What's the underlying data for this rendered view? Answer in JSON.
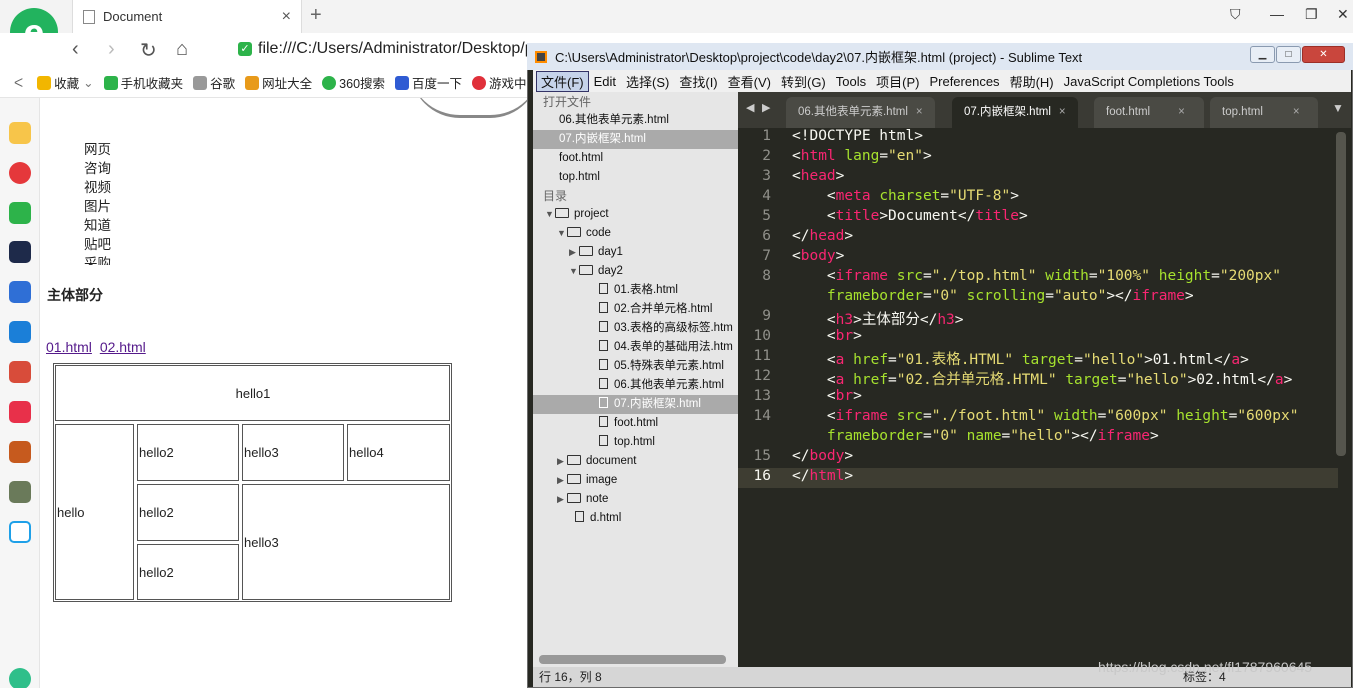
{
  "browser": {
    "tab_title": "Document",
    "tab_close": "×",
    "new_tab": "+",
    "address": "file:///C:/Users/Administrator/Desktop/p",
    "bookmarks": [
      {
        "label": "收藏",
        "icon": "star-icon",
        "color": "#f2b600"
      },
      {
        "label": "手机收藏夹",
        "icon": "phone-icon",
        "color": "#2db34a"
      },
      {
        "label": "谷歌",
        "icon": "page-icon",
        "color": "#999999"
      },
      {
        "label": "网址大全",
        "icon": "globe-icon",
        "color": "#e89a1a"
      },
      {
        "label": "360搜索",
        "icon": "search-360-icon",
        "color": "#2db34a"
      },
      {
        "label": "百度一下",
        "icon": "paw-icon",
        "color": "#2f5bd3"
      },
      {
        "label": "游戏中心",
        "icon": "game-icon",
        "color": "#e0303a"
      }
    ]
  },
  "page": {
    "menu_items": [
      "网页",
      "咨询",
      "视频",
      "图片",
      "知道",
      "贴吧",
      "采购"
    ],
    "heading": "主体部分",
    "links": [
      "01.html",
      "02.html"
    ],
    "table": {
      "top": "hello1",
      "left": "hello",
      "r1": [
        "hello2",
        "hello3",
        "hello4"
      ],
      "r2": "hello2",
      "r3": "hello2",
      "merged": "hello3"
    }
  },
  "sublime": {
    "title": "C:\\Users\\Administrator\\Desktop\\project\\code\\day2\\07.内嵌框架.html (project) - Sublime Text",
    "menus": [
      "文件(F)",
      "Edit",
      "选择(S)",
      "查找(I)",
      "查看(V)",
      "转到(G)",
      "Tools",
      "项目(P)",
      "Preferences",
      "帮助(H)",
      "JavaScript Completions Tools"
    ],
    "open_files_header": "打开文件",
    "open_files": [
      "06.其他表单元素.html",
      "07.内嵌框架.html",
      "foot.html",
      "top.html"
    ],
    "folders_header": "目录",
    "tree": {
      "project": "project",
      "code": "code",
      "day1": "day1",
      "day2": "day2",
      "day2_files": [
        "01.表格.html",
        "02.合并单元格.html",
        "03.表格的高级标签.htm",
        "04.表单的基础用法.htm",
        "05.特殊表单元素.html",
        "06.其他表单元素.html",
        "07.内嵌框架.html",
        "foot.html",
        "top.html"
      ],
      "others": [
        "document",
        "image",
        "note"
      ],
      "root_file": "d.html"
    },
    "tabs": [
      "06.其他表单元素.html",
      "07.内嵌框架.html",
      "foot.html",
      "top.html"
    ],
    "status": "行 16，列 8",
    "status_right": "标签：4",
    "watermark": "https://blog.csdn.net/fl1787960645",
    "line_numbers": [
      "1",
      "2",
      "3",
      "4",
      "5",
      "6",
      "7",
      "8",
      "9",
      "10",
      "11",
      "12",
      "13",
      "14",
      "15",
      "16"
    ],
    "code_lines": [
      "<!DOCTYPE html>",
      "<html lang=\"en\">",
      "<head>",
      "    <meta charset=\"UTF-8\">",
      "    <title>Document</title>",
      "</head>",
      "<body>",
      "    <iframe src=\"./top.html\" width=\"100%\" height=\"200px\"",
      "    frameborder=\"0\" scrolling=\"auto\"></iframe>",
      "    <h3>主体部分</h3>",
      "    <br>",
      "    <a href=\"01.表格.HTML\" target=\"hello\">01.html</a>",
      "    <a href=\"02.合并单元格.HTML\" target=\"hello\">02.html</a>",
      "    <br>",
      "    <iframe src=\"./foot.html\" width=\"600px\" height=\"600px\"",
      "    frameborder=\"0\" name=\"hello\"></iframe>",
      "</body>",
      "</html>"
    ]
  }
}
